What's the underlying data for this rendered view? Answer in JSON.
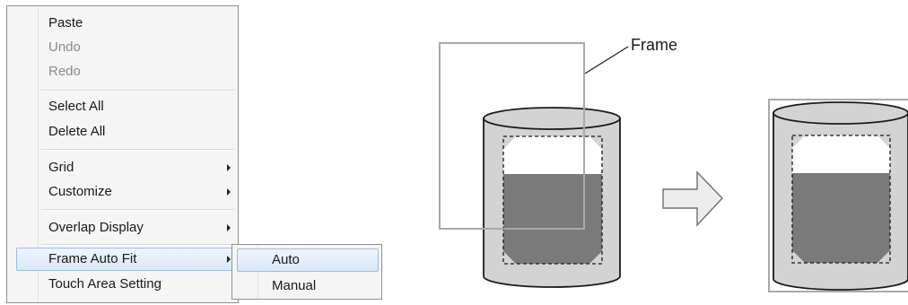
{
  "context_menu": {
    "items": [
      {
        "label": "Paste",
        "enabled": true
      },
      {
        "label": "Undo",
        "enabled": false
      },
      {
        "label": "Redo",
        "enabled": false
      },
      {
        "label": "Select All",
        "enabled": true
      },
      {
        "label": "Delete All",
        "enabled": true
      },
      {
        "label": "Grid",
        "enabled": true,
        "has_submenu": true
      },
      {
        "label": "Customize",
        "enabled": true,
        "has_submenu": true
      },
      {
        "label": "Overlap Display",
        "enabled": true,
        "has_submenu": true
      },
      {
        "label": "Frame Auto Fit",
        "enabled": true,
        "has_submenu": true,
        "highlighted": true
      },
      {
        "label": "Touch Area Setting",
        "enabled": true
      }
    ],
    "submenu": {
      "parent": "Frame Auto Fit",
      "items": [
        {
          "label": "Auto",
          "highlighted": true
        },
        {
          "label": "Manual"
        }
      ]
    }
  },
  "diagram": {
    "callout_label": "Frame",
    "arrow": "right-arrow",
    "colors": {
      "tank_body": "#d3d3d3",
      "tank_fill": "#7a7a7a",
      "frame": "#a9a9a9",
      "outline": "#1a1a1a"
    }
  }
}
